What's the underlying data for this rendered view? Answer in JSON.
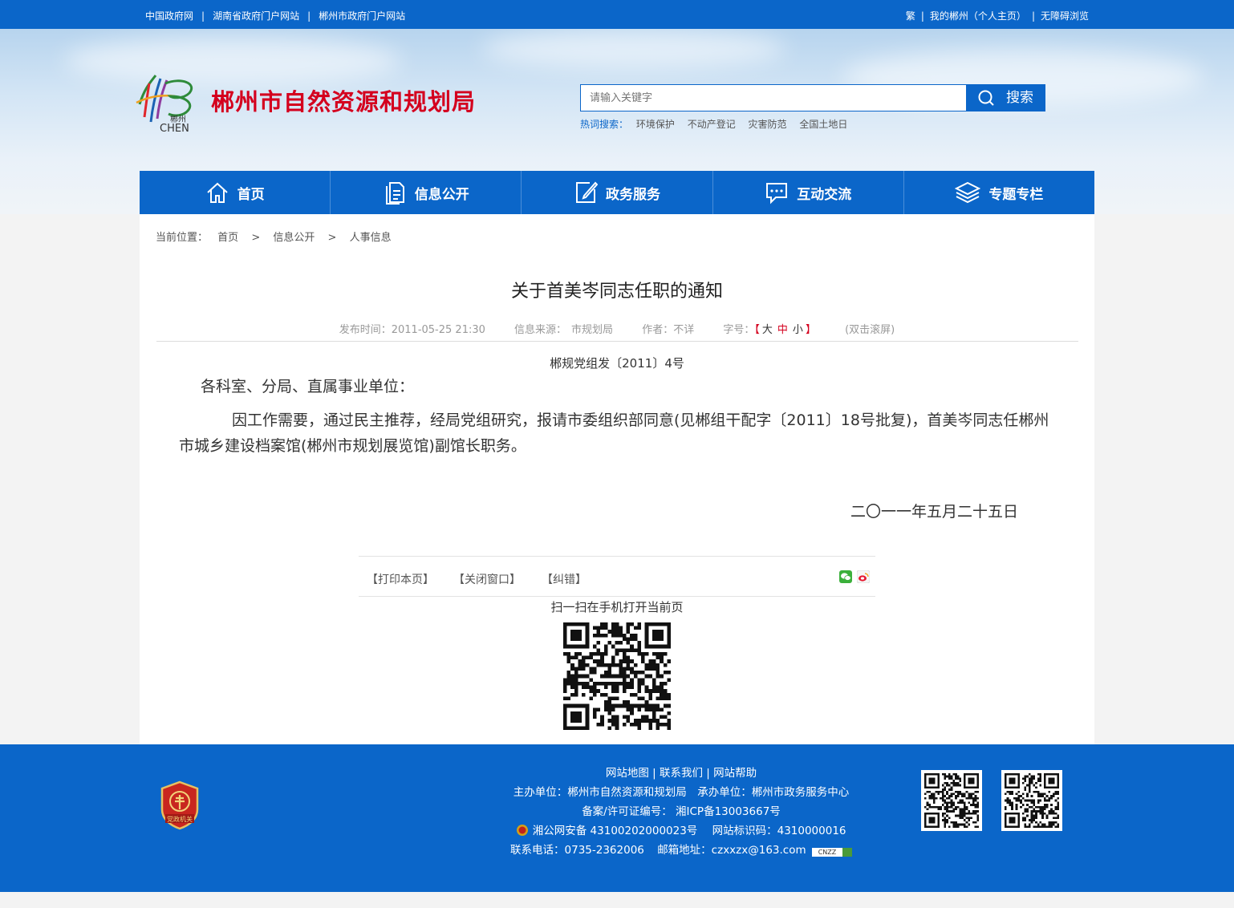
{
  "topbar": {
    "links_left": [
      "中国政府网",
      "湖南省政府门户网站",
      "郴州市政府门户网站"
    ],
    "links_right": [
      "繁",
      "我的郴州（个人主页）",
      "无障碍浏览"
    ],
    "separator": "|"
  },
  "header": {
    "site_title": "郴州市自然资源和规划局",
    "logo_text_cn": "郴州",
    "logo_text_en": "CHEN",
    "search": {
      "placeholder": "请输入关键字",
      "button_label": "搜索"
    },
    "hot": {
      "label": "热词搜索：",
      "items": [
        "环境保护",
        "不动产登记",
        "灾害防范",
        "全国土地日"
      ]
    }
  },
  "nav": {
    "items": [
      {
        "label": "首页",
        "icon": "home-icon"
      },
      {
        "label": "信息公开",
        "icon": "document-icon"
      },
      {
        "label": "政务服务",
        "icon": "edit-icon"
      },
      {
        "label": "互动交流",
        "icon": "chat-icon"
      },
      {
        "label": "专题专栏",
        "icon": "layers-icon"
      }
    ]
  },
  "breadcrumb": {
    "prefix": "当前位置：",
    "items": [
      "首页",
      "信息公开",
      "人事信息"
    ],
    "separator": ">"
  },
  "article": {
    "title": "关于首美岑同志任职的通知",
    "meta": {
      "publish_time": "发布时间：2011-05-25 21:30",
      "source_label": "信息来源：",
      "source": "市规划局",
      "author": "作者：不详",
      "fontsize_label": "字号：",
      "bracket_open": "【",
      "fontsizes": [
        "大",
        "中",
        "小"
      ],
      "bracket_close": "】",
      "dblclick": "(双击滚屏)"
    },
    "doc_number": "郴规党组发〔2011〕4号",
    "greeting": "各科室、分局、直属事业单位：",
    "body": "因工作需要，通过民主推荐，经局党组研究，报请市委组织部同意(见郴组干配字〔2011〕18号批复)，首美岑同志任郴州市城乡建设档案馆(郴州市规划展览馆)副馆长职务。",
    "date": "二〇一一年五月二十五日"
  },
  "toolbar": {
    "print": "【打印本页】",
    "close": "【关闭窗口】",
    "correct": "【纠错】",
    "share_icons": [
      "wechat-icon",
      "weibo-icon"
    ]
  },
  "qr": {
    "scan_text": "扫一扫在手机打开当前页"
  },
  "footer": {
    "links": [
      "网站地图",
      "联系我们",
      "网站帮助"
    ],
    "sponsor": "主办单位：郴州市自然资源和规划局　承办单位：郴州市政务服务中心",
    "icp": "备案/许可证编号： 湘ICP备13003667号",
    "police": "湘公网安备 43100202000023号",
    "site_code": "网站标识码：4310000016",
    "phone": "联系电话：0735-2362006",
    "email": "邮箱地址：czxxzx@163.com",
    "badge_text": "党政机关",
    "cnzz": "CNZZ"
  },
  "colors": {
    "brand_blue": "#0b66c9",
    "title_red": "#d4001e"
  }
}
